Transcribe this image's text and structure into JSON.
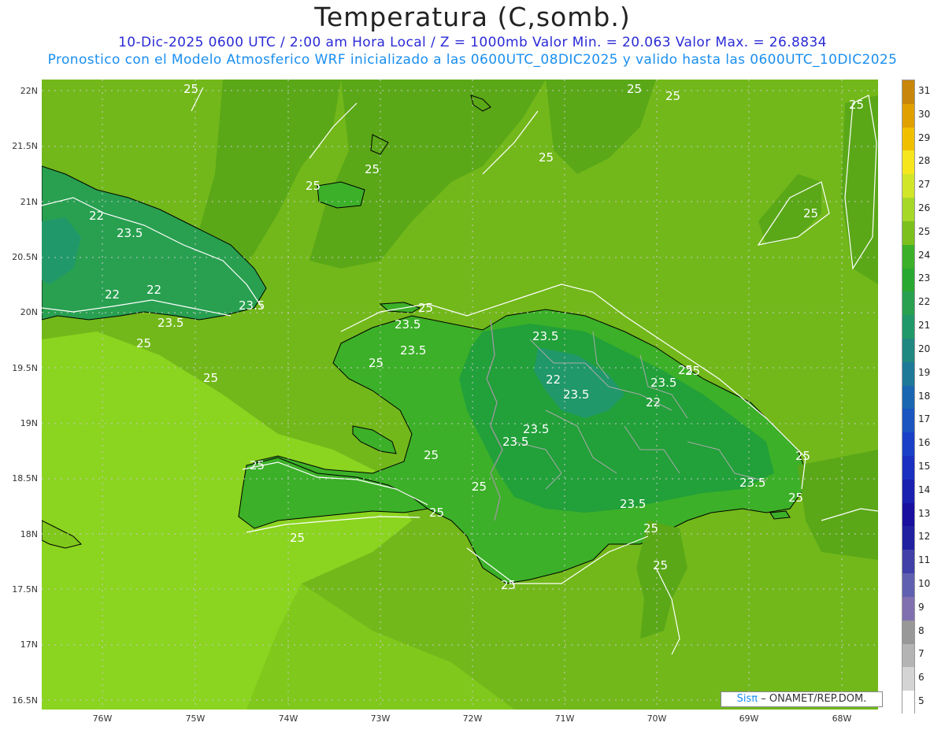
{
  "header": {
    "title": "Temperatura (C,somb.)",
    "line1": "10-Dic-2025  0600 UTC / 2:00 am Hora Local / Z = 1000mb    Valor Min. = 20.063  Valor Max. = 26.8834",
    "line2": "Pronostico con el Modelo Atmosferico WRF inicializado a las 0600UTC_08DIC2025 y valido hasta las  0600UTC_10DIC2025"
  },
  "axes": {
    "lat_labels": [
      "22N",
      "21.5N",
      "21N",
      "20.5N",
      "20N",
      "19.5N",
      "19N",
      "18.5N",
      "18N",
      "17.5N",
      "17N",
      "16.5N"
    ],
    "lon_labels": [
      "76W",
      "75W",
      "74W",
      "73W",
      "72W",
      "71W",
      "70W",
      "69W",
      "68W"
    ]
  },
  "colorbar": {
    "labels": [
      "31",
      "30",
      "29",
      "28",
      "27",
      "26",
      "25",
      "24",
      "23",
      "22",
      "21",
      "20",
      "19",
      "18",
      "17",
      "16",
      "15",
      "14",
      "13",
      "12",
      "11",
      "10",
      "9",
      "8",
      "7",
      "6",
      "5"
    ],
    "colors": [
      "#c8860a",
      "#e0a000",
      "#f0c000",
      "#f5e61e",
      "#d2e628",
      "#a6d828",
      "#7cc01e",
      "#3cb028",
      "#28a830",
      "#28a050",
      "#20986a",
      "#208880",
      "#1e7898",
      "#1a66b0",
      "#1a55c0",
      "#1a40c8",
      "#1a30c0",
      "#1a20b0",
      "#1a10a0",
      "#2020a0",
      "#4040a8",
      "#6060b0",
      "#8070b0",
      "#989898",
      "#b4b4b4",
      "#d4d4d4",
      "#ffffff"
    ]
  },
  "map": {
    "colors": {
      "ocean_light": "#8bd420",
      "ocean_mid": "#72b81a",
      "ocean_dark": "#5aa818",
      "land_warm": "#3cb028",
      "land_cool": "#22a03a",
      "contour": "#ffffff",
      "coast": "#000000",
      "border": "#999999"
    },
    "contour_labels": [
      "25",
      "25",
      "25",
      "25",
      "25",
      "25",
      "22",
      "23.5",
      "22",
      "22",
      "23.5",
      "23.5",
      "25",
      "25",
      "25",
      "23.5",
      "25",
      "23.5",
      "25",
      "23.5",
      "22",
      "23.5",
      "22",
      "25",
      "23.5",
      "23.5",
      "23.5",
      "25",
      "25",
      "25",
      "25",
      "25",
      "25",
      "25",
      "23.5",
      "25",
      "23.5",
      "25",
      "25",
      "25",
      "25"
    ]
  },
  "credit": {
    "brand": "Sisπ",
    "text": "– ONAMET/REP.DOM."
  }
}
